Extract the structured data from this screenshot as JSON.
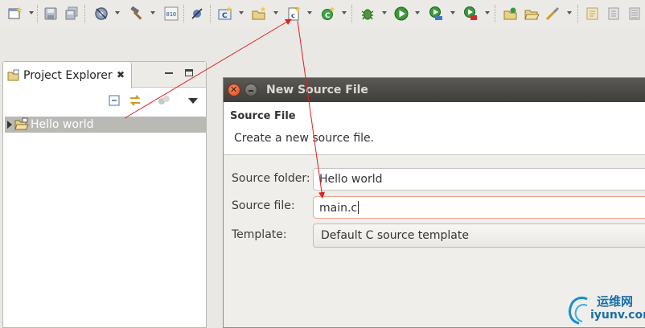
{
  "toolbar": {
    "buttons": [
      {
        "name": "new-wizard-icon",
        "dropdown": true
      },
      {
        "name": "save-icon",
        "dropdown": false
      },
      {
        "name": "save-all-icon",
        "dropdown": false
      },
      {
        "name": "build-config-gear-icon",
        "dropdown": true
      },
      {
        "name": "hammer-icon",
        "dropdown": true
      },
      {
        "name": "binary-010-icon",
        "dropdown": false
      },
      {
        "name": "skip-breakpoints-icon",
        "dropdown": false
      },
      {
        "name": "new-c-project-icon",
        "dropdown": true
      },
      {
        "name": "new-folder-icon",
        "dropdown": true
      },
      {
        "name": "new-source-file-icon",
        "dropdown": true
      },
      {
        "name": "new-class-icon",
        "dropdown": true
      },
      {
        "name": "debug-bug-icon",
        "dropdown": true
      },
      {
        "name": "run-icon",
        "dropdown": true
      },
      {
        "name": "run-coverage-icon",
        "dropdown": true
      },
      {
        "name": "external-tools-icon",
        "dropdown": true
      },
      {
        "name": "open-type-icon",
        "dropdown": false
      },
      {
        "name": "open-folder-icon",
        "dropdown": false
      },
      {
        "name": "search-brush-icon",
        "dropdown": true
      },
      {
        "name": "annotation-icon",
        "dropdown": false
      },
      {
        "name": "document-icon",
        "dropdown": false
      },
      {
        "name": "list-icon",
        "dropdown": false
      }
    ]
  },
  "project_explorer": {
    "title": "Project Explorer",
    "close_glyph": "✖",
    "tree": [
      {
        "label": "Hello world",
        "expanded": false,
        "selected": true
      }
    ]
  },
  "dialog": {
    "title": "New Source File",
    "close_glyph": "✕",
    "banner": {
      "heading": "Source File",
      "description": "Create a new source file."
    },
    "source_folder": {
      "label": "Source folder:",
      "value": "Hello world"
    },
    "source_file": {
      "label": "Source file:",
      "value": "main.c"
    },
    "template": {
      "label": "Template:",
      "value": "Default C source template"
    }
  },
  "watermark": {
    "line1": "运维网",
    "line2": "iyunv.com"
  },
  "colors": {
    "annotation_arrow": "#e02020",
    "selection": "#b9b9b5",
    "title_bar": "#4a4945"
  }
}
